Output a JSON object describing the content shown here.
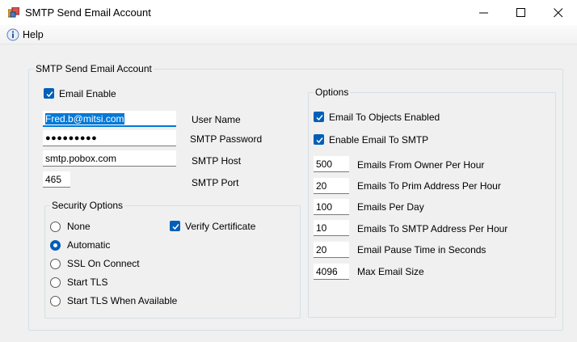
{
  "window": {
    "title": "SMTP Send Email Account"
  },
  "menu": {
    "help_label": "Help"
  },
  "main_group": {
    "title": "SMTP Send Email Account"
  },
  "email_enable": {
    "label": "Email Enable",
    "checked": true
  },
  "fields": {
    "user_name": {
      "value": "Fred.b@mitsi.com",
      "label": "User Name"
    },
    "smtp_password": {
      "value": "●●●●●●●●●",
      "label": "SMTP Password"
    },
    "smtp_host": {
      "value": "smtp.pobox.com",
      "label": "SMTP Host"
    },
    "smtp_port": {
      "value": "465",
      "label": "SMTP Port"
    }
  },
  "security": {
    "title": "Security Options",
    "options": [
      "None",
      "Automatic",
      "SSL On Connect",
      "Start TLS",
      "Start TLS When Available"
    ],
    "selected": "Automatic",
    "verify_certificate": {
      "label": "Verify Certificate",
      "checked": true
    }
  },
  "options_group": {
    "title": "Options",
    "email_to_objects": {
      "label": "Email To Objects Enabled",
      "checked": true
    },
    "enable_email_to_smtp": {
      "label": "Enable Email To SMTP",
      "checked": true
    },
    "rows": [
      {
        "value": "500",
        "label": "Emails From Owner Per Hour"
      },
      {
        "value": "20",
        "label": "Emails To Prim Address Per Hour"
      },
      {
        "value": "100",
        "label": "Emails Per Day"
      },
      {
        "value": "10",
        "label": "Emails To SMTP Address Per Hour"
      },
      {
        "value": "20",
        "label": "Email Pause Time in Seconds"
      },
      {
        "value": "4096",
        "label": "Max Email Size"
      }
    ]
  },
  "colors": {
    "accent": "#005fb8",
    "focus": "#0078d7",
    "background": "#f0f0f0"
  },
  "icons": [
    "app-icon",
    "help-info-icon",
    "minimize-icon",
    "maximize-icon",
    "close-icon",
    "checkmark-icon"
  ]
}
